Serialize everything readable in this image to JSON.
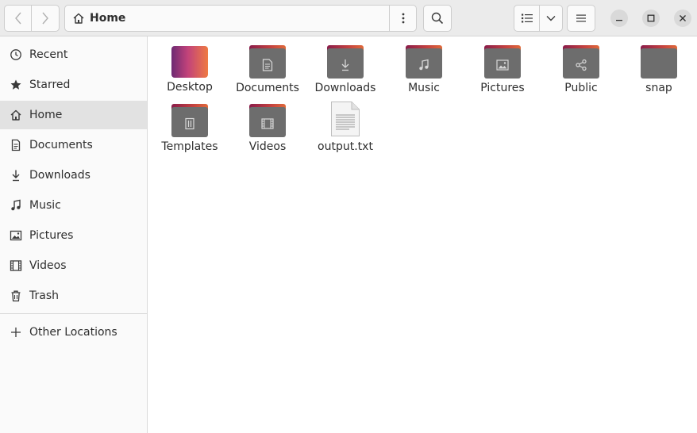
{
  "window": {
    "path_label": "Home"
  },
  "sidebar": {
    "items": [
      {
        "label": "Recent",
        "icon": "clock-icon"
      },
      {
        "label": "Starred",
        "icon": "star-icon"
      },
      {
        "label": "Home",
        "icon": "home-icon",
        "active": true
      },
      {
        "label": "Documents",
        "icon": "document-icon"
      },
      {
        "label": "Downloads",
        "icon": "download-icon"
      },
      {
        "label": "Music",
        "icon": "music-icon"
      },
      {
        "label": "Pictures",
        "icon": "image-icon"
      },
      {
        "label": "Videos",
        "icon": "film-icon"
      },
      {
        "label": "Trash",
        "icon": "trash-icon"
      }
    ],
    "other_locations": "Other Locations"
  },
  "files": [
    {
      "label": "Desktop",
      "kind": "desktop"
    },
    {
      "label": "Documents",
      "kind": "folder",
      "icon": "document-icon"
    },
    {
      "label": "Downloads",
      "kind": "folder",
      "icon": "download-icon"
    },
    {
      "label": "Music",
      "kind": "folder",
      "icon": "music-icon"
    },
    {
      "label": "Pictures",
      "kind": "folder",
      "icon": "image-icon"
    },
    {
      "label": "Public",
      "kind": "folder",
      "icon": "share-icon"
    },
    {
      "label": "snap",
      "kind": "folder",
      "icon": ""
    },
    {
      "label": "Templates",
      "kind": "folder",
      "icon": "template-icon"
    },
    {
      "label": "Videos",
      "kind": "folder",
      "icon": "film-icon"
    },
    {
      "label": "output.txt",
      "kind": "text-file"
    }
  ],
  "colors": {
    "folder_gray": "#6d6d6d",
    "folder_tab_start": "#8a1c4a",
    "folder_tab_end": "#e06a3a",
    "sidebar_active": "#e2e2e2"
  }
}
